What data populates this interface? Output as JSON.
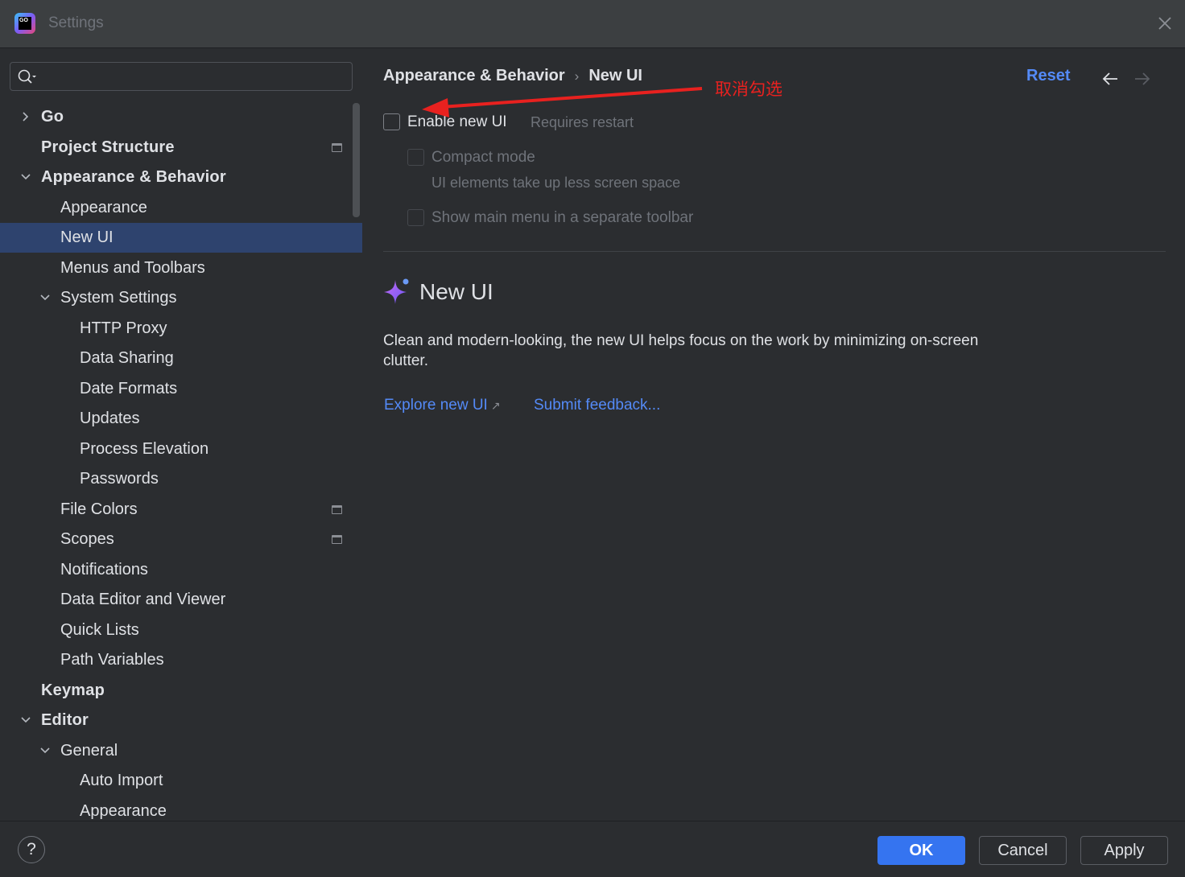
{
  "window": {
    "title": "Settings",
    "logo_text": "GO"
  },
  "search": {
    "placeholder": "",
    "value": ""
  },
  "tree": [
    {
      "label": "Go",
      "bold": true,
      "chevron": "right"
    },
    {
      "label": "Project Structure",
      "bold": true,
      "icon": "project-scope-icon"
    },
    {
      "label": "Appearance & Behavior",
      "bold": true,
      "chevron": "down"
    },
    {
      "label": "Appearance"
    },
    {
      "label": "New UI",
      "selected": true
    },
    {
      "label": "Menus and Toolbars"
    },
    {
      "label": "System Settings",
      "chevron": "down"
    },
    {
      "label": "HTTP Proxy"
    },
    {
      "label": "Data Sharing"
    },
    {
      "label": "Date Formats"
    },
    {
      "label": "Updates"
    },
    {
      "label": "Process Elevation"
    },
    {
      "label": "Passwords"
    },
    {
      "label": "File Colors",
      "icon": "project-scope-icon"
    },
    {
      "label": "Scopes",
      "icon": "project-scope-icon"
    },
    {
      "label": "Notifications"
    },
    {
      "label": "Data Editor and Viewer"
    },
    {
      "label": "Quick Lists"
    },
    {
      "label": "Path Variables"
    },
    {
      "label": "Keymap",
      "bold": true
    },
    {
      "label": "Editor",
      "bold": true,
      "chevron": "down"
    },
    {
      "label": "General",
      "chevron": "down"
    },
    {
      "label": "Auto Import"
    },
    {
      "label": "Appearance"
    }
  ],
  "main": {
    "breadcrumb": {
      "parent": "Appearance & Behavior",
      "separator": "›",
      "current": "New UI"
    },
    "reset_label": "Reset",
    "enable_new_ui": {
      "label": "Enable new UI",
      "checked": false,
      "hint": "Requires restart"
    },
    "compact_mode": {
      "label": "Compact mode",
      "checked": false,
      "enabled": false,
      "hint": "UI elements take up less screen space"
    },
    "separate_toolbar": {
      "label": "Show main menu in a separate toolbar",
      "checked": false,
      "enabled": false
    },
    "section_title": "New UI",
    "description": "Clean and modern-looking, the new UI helps focus on the work by minimizing on-screen clutter.",
    "explore_link": "Explore new UI",
    "external_arrow": "↗",
    "feedback_link": "Submit feedback..."
  },
  "annotation": {
    "text": "取消勾选",
    "color": "#e8211f"
  },
  "footer": {
    "help": "?",
    "ok": "OK",
    "cancel": "Cancel",
    "apply": "Apply"
  },
  "colors": {
    "accent": "#3574f0",
    "link": "#548af7",
    "selection": "#2e436e",
    "background": "#2b2d30"
  }
}
